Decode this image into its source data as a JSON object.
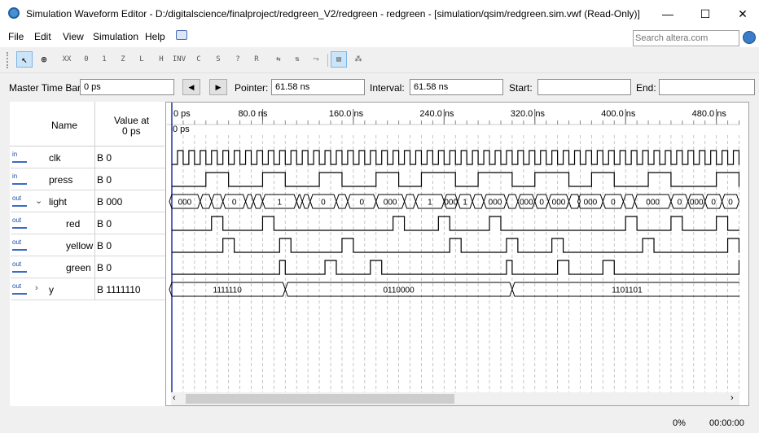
{
  "window": {
    "title": "Simulation Waveform Editor - D:/digitalscience/finalproject/redgreen_V2/redgreen - redgreen - [simulation/qsim/redgreen.sim.vwf (Read-Only)]",
    "minimize": "—",
    "maximize": "☐",
    "close": "✕"
  },
  "menu": {
    "items": [
      "File",
      "Edit",
      "View",
      "Simulation",
      "Help"
    ],
    "search_placeholder": "Search altera.com"
  },
  "toolbar": {
    "icons": [
      "pointer-tool",
      "zoom-tool",
      "uninitialized",
      "forcing-low",
      "forcing-high",
      "high-impedance",
      "weak-low",
      "weak-high",
      "invert",
      "count-value",
      "clock",
      "arbitrary",
      "random",
      "snap-to-grid",
      "sort",
      "group",
      "compare"
    ]
  },
  "timebar": {
    "master_label": "Master Time Bar:",
    "master_value": "0 ps",
    "pointer_label": "Pointer:",
    "pointer_value": "61.58 ns",
    "interval_label": "Interval:",
    "interval_value": "61.58 ns",
    "start_label": "Start:",
    "start_value": "",
    "end_label": "End:",
    "end_value": ""
  },
  "grid": {
    "name_header": "Name",
    "value_header_line1": "Value at",
    "value_header_line2": "0 ps",
    "ticks": [
      "0 ps",
      "80.0 ns",
      "160.0 ns",
      "240.0 ns",
      "320.0 ns",
      "400.0 ns",
      "480.0 ns"
    ],
    "cursor_label": "0 ps"
  },
  "signals": [
    {
      "name": "clk",
      "dir": "in",
      "value": "B 0"
    },
    {
      "name": "press",
      "dir": "in",
      "value": "B 0"
    },
    {
      "name": "light",
      "dir": "out",
      "value": "B 000",
      "expanded": true
    },
    {
      "name": "red",
      "dir": "out",
      "value": "B 0"
    },
    {
      "name": "yellow",
      "dir": "out",
      "value": "B 0"
    },
    {
      "name": "green",
      "dir": "out",
      "value": "B 0"
    },
    {
      "name": "y",
      "dir": "out",
      "value": "B 1111110",
      "expanded": false
    }
  ],
  "bus_labels": {
    "light": [
      "000",
      "0",
      "000",
      "0",
      "1",
      "000",
      "1",
      "0",
      "000",
      "0",
      "000",
      "0",
      "000",
      "0",
      "1",
      "000",
      "1",
      "0",
      "000",
      "0",
      "000",
      "0",
      "000",
      "0"
    ],
    "y": [
      "1111110",
      "0110000",
      "1101101"
    ]
  },
  "status": {
    "progress": "0%",
    "time": "00:00:00"
  }
}
